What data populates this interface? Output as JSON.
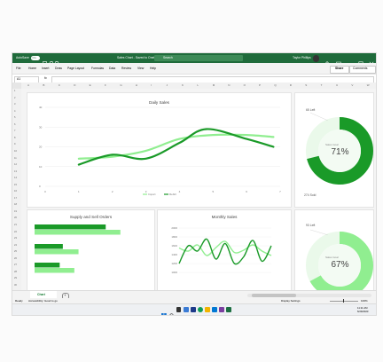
{
  "window": {
    "autosave_label": "AutoSave",
    "autosave_state": "On",
    "doc_title": "Sales Chart - Saved to OneDrive",
    "search_placeholder": "Search",
    "user_name": "Taylor Phillips"
  },
  "menu": [
    "File",
    "Home",
    "Insert",
    "Draw",
    "Page Layout",
    "Formulas",
    "Data",
    "Review",
    "View",
    "Help"
  ],
  "share_label": "Share",
  "comments_label": "Comments",
  "namebox": "A1",
  "fx_label": "fx",
  "columns": [
    "A",
    "B",
    "C",
    "D",
    "E",
    "F",
    "G",
    "H",
    "I",
    "J",
    "K",
    "L",
    "M",
    "N",
    "O",
    "P",
    "Q",
    "R",
    "S",
    "T",
    "U",
    "V",
    "W"
  ],
  "rows": [
    "1",
    "2",
    "3",
    "4",
    "5",
    "6",
    "7",
    "8",
    "9",
    "10",
    "11",
    "12",
    "13",
    "14",
    "15",
    "16",
    "17",
    "18",
    "19",
    "20",
    "21",
    "22",
    "23",
    "24",
    "25",
    "26",
    "27",
    "28",
    "29",
    "30"
  ],
  "colors": {
    "dark_green": "#1a9a28",
    "light_green": "#90ee90",
    "ribbon": "#1f6b3b",
    "pale_green": "#eaf9ea"
  },
  "charts": {
    "daily_sales": {
      "type": "line",
      "title": "Daily Sales",
      "x": [
        0,
        1,
        2,
        3,
        4,
        5,
        6,
        7
      ],
      "y_ticks": [
        "0",
        "10",
        "20",
        "30",
        "40"
      ],
      "ylim": [
        0,
        40
      ],
      "legend": [
        "Import",
        "Rebill"
      ],
      "series": [
        {
          "name": "Import",
          "color": "#90ee90",
          "points": [
            [
              1,
              14
            ],
            [
              2,
              15
            ],
            [
              3,
              18
            ],
            [
              4,
              24
            ],
            [
              5,
              26
            ],
            [
              6,
              26
            ],
            [
              6.8,
              25
            ]
          ]
        },
        {
          "name": "Rebill",
          "color": "#1a9a28",
          "points": [
            [
              1,
              11
            ],
            [
              2,
              16
            ],
            [
              3,
              14
            ],
            [
              4,
              22
            ],
            [
              4.8,
              29
            ],
            [
              6,
              24
            ],
            [
              6.8,
              20
            ]
          ]
        }
      ]
    },
    "donut_top": {
      "type": "pie",
      "top_label": "65 Left",
      "center_label": "Sales Goal",
      "value_label": "71%",
      "value": 71,
      "bottom_label": "274 Sold",
      "color": "#1a9a28"
    },
    "supply_sell": {
      "type": "bar",
      "title": "Supply and Sell Orders",
      "series": [
        {
          "name": "",
          "color": "#1a9a28",
          "values": [
            68,
            27,
            24
          ]
        },
        {
          "name": "",
          "color": "#90ee90",
          "values": [
            82,
            42,
            38
          ]
        }
      ]
    },
    "monthly_sales": {
      "type": "line",
      "title": "Monthly Sales",
      "y_ticks": [
        "1000",
        "1200",
        "1400",
        "1600",
        "1800",
        "2000"
      ],
      "ylim": [
        1000,
        2000
      ],
      "series": [
        {
          "name": "",
          "color": "#90ee90",
          "points": [
            [
              0,
              1550
            ],
            [
              1,
              1480
            ],
            [
              2,
              1620
            ],
            [
              3,
              1380
            ],
            [
              4,
              1560
            ],
            [
              5,
              1700
            ],
            [
              6,
              1450
            ],
            [
              7,
              1500
            ],
            [
              8,
              1620
            ],
            [
              9,
              1480
            ],
            [
              10,
              1380
            ]
          ]
        },
        {
          "name": "",
          "color": "#1a9a28",
          "points": [
            [
              0,
              1200
            ],
            [
              1,
              1600
            ],
            [
              2,
              1480
            ],
            [
              3,
              1750
            ],
            [
              4,
              1300
            ],
            [
              5,
              1650
            ],
            [
              6,
              1200
            ],
            [
              7,
              1350
            ],
            [
              8,
              1720
            ],
            [
              9,
              1250
            ],
            [
              10,
              1600
            ]
          ]
        }
      ]
    },
    "donut_bottom": {
      "type": "pie",
      "top_label": "93 Left",
      "center_label": "Sales Goal",
      "value_label": "67%",
      "value": 67,
      "color": "#90ee90"
    }
  },
  "sheet_tab": "Chart",
  "status": {
    "ready": "Ready",
    "accessibility": "Accessibility: Good to go",
    "display": "Display Settings",
    "zoom": "100%"
  },
  "tray": {
    "time": "11:11 AM",
    "date": "6/29/2023"
  }
}
